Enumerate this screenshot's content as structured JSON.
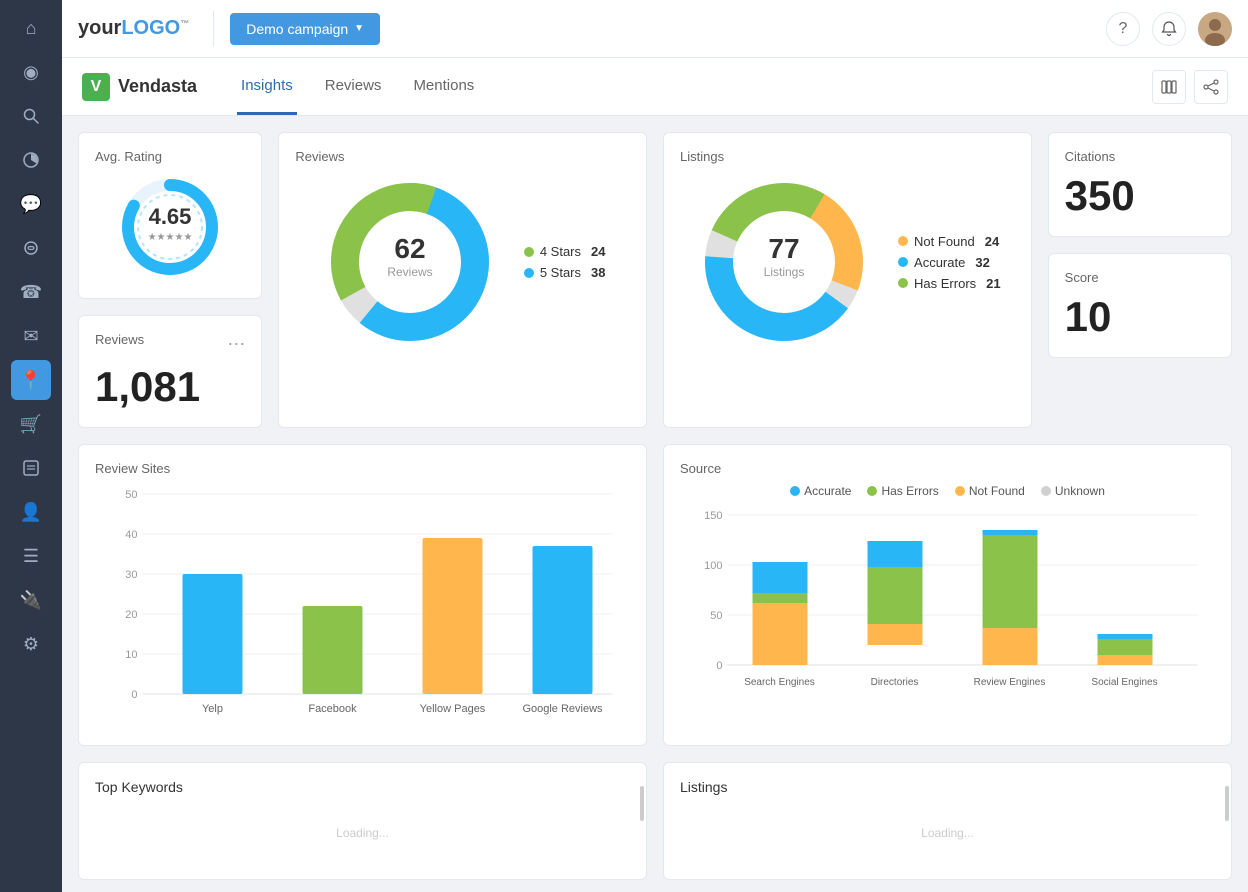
{
  "topbar": {
    "logo_text": "your LOGO",
    "demo_campaign_label": "Demo campaign",
    "help_icon": "?",
    "bell_icon": "🔔"
  },
  "subheader": {
    "brand_name": "Vendasta",
    "tabs": [
      "Insights",
      "Reviews",
      "Mentions"
    ],
    "active_tab": "Insights"
  },
  "avg_rating": {
    "title": "Avg. Rating",
    "value": "4.65"
  },
  "reviews_count": {
    "title": "Reviews",
    "value": "1,081"
  },
  "reviews_donut": {
    "title": "Reviews",
    "total": "62",
    "center_label": "Reviews",
    "legend": [
      {
        "label": "4 Stars",
        "value": "24",
        "color": "#8bc34a"
      },
      {
        "label": "5 Stars",
        "value": "38",
        "color": "#29b6f6"
      }
    ]
  },
  "listings_donut": {
    "title": "Listings",
    "total": "77",
    "center_label": "Listings",
    "legend": [
      {
        "label": "Not Found",
        "value": "24",
        "color": "#ffb74d"
      },
      {
        "label": "Accurate",
        "value": "32",
        "color": "#29b6f6"
      },
      {
        "label": "Has Errors",
        "value": "21",
        "color": "#8bc34a"
      }
    ]
  },
  "citations": {
    "title": "Citations",
    "value": "350"
  },
  "score": {
    "title": "Score",
    "value": "10"
  },
  "review_sites": {
    "title": "Review Sites",
    "y_labels": [
      "50",
      "40",
      "30",
      "20",
      "10",
      "0"
    ],
    "bars": [
      {
        "label": "Yelp",
        "value": 30,
        "color": "#29b6f6"
      },
      {
        "label": "Facebook",
        "value": 22,
        "color": "#8bc34a"
      },
      {
        "label": "Yellow Pages",
        "value": 39,
        "color": "#ffb74d"
      },
      {
        "label": "Google Reviews",
        "value": 37,
        "color": "#29b6f6"
      }
    ],
    "max": 50
  },
  "source": {
    "title": "Source",
    "legend": [
      {
        "label": "Accurate",
        "color": "#29b6f6"
      },
      {
        "label": "Has Errors",
        "color": "#8bc34a"
      },
      {
        "label": "Not Found",
        "color": "#ffb74d"
      },
      {
        "label": "Unknown",
        "color": "#d0d0d0"
      }
    ],
    "y_labels": [
      "150",
      "100",
      "50",
      "0"
    ],
    "groups": [
      {
        "label": "Search Engines",
        "accurate": 30,
        "has_errors": 10,
        "not_found": 60,
        "unknown": 0
      },
      {
        "label": "Directories",
        "accurate": 25,
        "has_errors": 55,
        "not_found": 20,
        "unknown": 0
      },
      {
        "label": "Review Engines",
        "accurate": 5,
        "has_errors": 90,
        "not_found": 35,
        "unknown": 0
      },
      {
        "label": "Social Engines",
        "accurate": 5,
        "has_errors": 15,
        "not_found": 10,
        "unknown": 0
      }
    ],
    "max": 150
  },
  "top_keywords": {
    "title": "Top Keywords"
  },
  "listings_bottom": {
    "title": "Listings"
  },
  "sidebar_icons": [
    "⌂",
    "◎",
    "🔍",
    "◑",
    "💬",
    "🔭",
    "☎",
    "✉",
    "📍",
    "🛒",
    "📊",
    "👤",
    "☰",
    "🔌",
    "⚙"
  ]
}
